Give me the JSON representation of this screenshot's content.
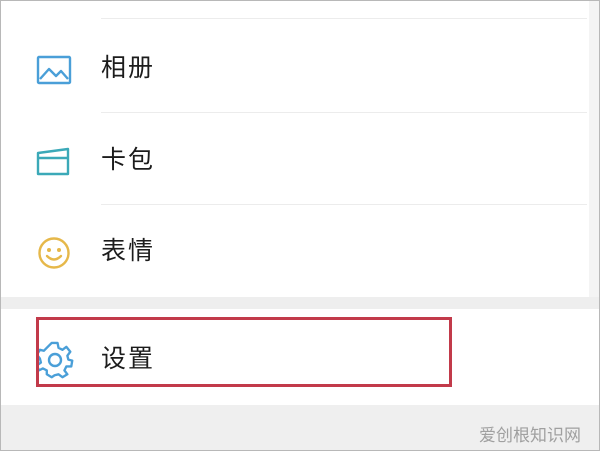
{
  "menu": {
    "items": [
      {
        "label": "相册",
        "icon": "image-icon"
      },
      {
        "label": "卡包",
        "icon": "card-icon"
      },
      {
        "label": "表情",
        "icon": "smiley-icon"
      }
    ],
    "settings": {
      "label": "设置",
      "icon": "gear-icon"
    }
  },
  "watermark": "爱创根知识网",
  "colors": {
    "icon_blue": "#4a9fd8",
    "icon_teal": "#3ba9b8",
    "icon_yellow": "#e6b84a",
    "highlight_border": "#c23a4a"
  }
}
